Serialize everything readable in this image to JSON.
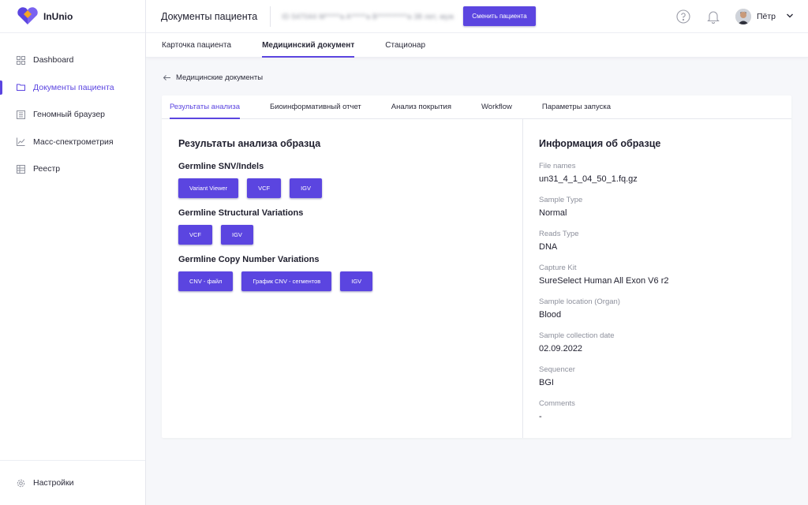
{
  "app": {
    "name": "InUnio",
    "colors": {
      "accent": "#5b45e0",
      "logo_purple": "#5b45e0",
      "logo_orange": "#f5a623"
    }
  },
  "sidebar": {
    "items": [
      {
        "label": "Dashboard",
        "icon": "dashboard-grid-icon",
        "active": false
      },
      {
        "label": "Документы пациента",
        "icon": "folder-icon",
        "active": true
      },
      {
        "label": "Геномный браузер",
        "icon": "genome-browser-icon",
        "active": false
      },
      {
        "label": "Масс-спектрометрия",
        "icon": "chart-line-icon",
        "active": false
      },
      {
        "label": "Реестр",
        "icon": "registry-table-icon",
        "active": false
      }
    ],
    "footer": {
      "label": "Настройки",
      "icon": "settings-gear-icon"
    }
  },
  "header": {
    "title": "Документы пациента",
    "patient_info": "ID 547044   M*****a  A*****a  B**********a   38 лет, муж",
    "switch_button": "Сменить пациента",
    "help_icon": "help-circle-icon",
    "bell_icon": "bell-icon",
    "user_name": "Пётр",
    "user_menu_icon": "chevron-down-icon"
  },
  "subnav": {
    "items": [
      {
        "label": "Карточка пациента",
        "active": false
      },
      {
        "label": "Медицинский документ",
        "active": true
      },
      {
        "label": "Стационар",
        "active": false
      }
    ]
  },
  "breadcrumb": {
    "back_label": "Медицинские документы"
  },
  "card": {
    "tabs": [
      {
        "label": "Результаты анализа",
        "active": true
      },
      {
        "label": "Биоинформативный отчет",
        "active": false
      },
      {
        "label": "Анализ покрытия",
        "active": false
      },
      {
        "label": "Workflow",
        "active": false
      },
      {
        "label": "Параметры запуска",
        "active": false
      }
    ],
    "results": {
      "title": "Результаты анализа образца",
      "sections": [
        {
          "title": "Germline SNV/Indels",
          "buttons": [
            "Variant Viewer",
            "VCF",
            "IGV"
          ]
        },
        {
          "title": "Germline Structural Variations",
          "buttons": [
            "VCF",
            "IGV"
          ]
        },
        {
          "title": "Germline Copy Number Variations",
          "buttons": [
            "CNV - файл",
            "График CNV - сегментов",
            "IGV"
          ]
        }
      ]
    },
    "info": {
      "title": "Информация об образце",
      "fields": [
        {
          "label": "File names",
          "value": "un31_4_1_04_50_1.fq.gz"
        },
        {
          "label": "Sample Type",
          "value": "Normal"
        },
        {
          "label": "Reads Type",
          "value": "DNA"
        },
        {
          "label": "Capture Kit",
          "value": "SureSelect Human All Exon V6 r2"
        },
        {
          "label": "Sample location (Organ)",
          "value": "Blood"
        },
        {
          "label": "Sample collection date",
          "value": "02.09.2022"
        },
        {
          "label": "Sequencer",
          "value": "BGI"
        },
        {
          "label": "Comments",
          "value": "-"
        }
      ]
    }
  }
}
